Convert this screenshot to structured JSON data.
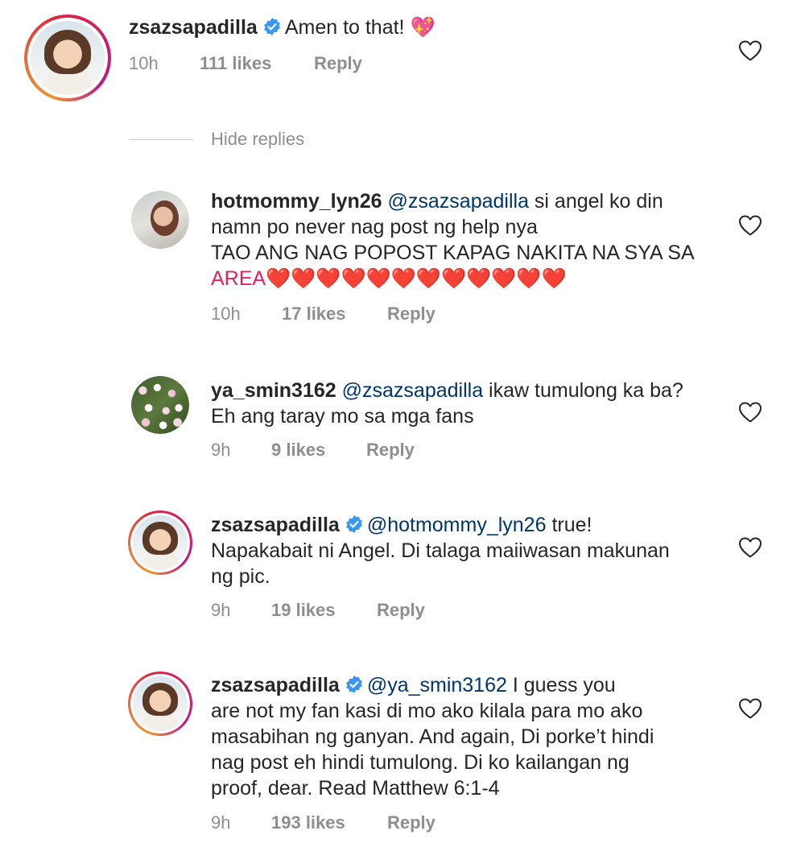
{
  "comments": [
    {
      "username": "zsazsapadilla",
      "verified": true,
      "text": "Amen to that! 💖",
      "time": "10h",
      "likes": "111 likes",
      "reply": "Reply"
    }
  ],
  "hide_replies": "Hide replies",
  "replies": [
    {
      "username": "hotmommy_lyn26",
      "verified": false,
      "mention": "@zsazsapadilla",
      "text_line1": " si angel ko din",
      "text_line2": "namn po never nag post ng help nya",
      "text_line3": "TAO ANG NAG POPOST KAPAG NAKITA NA SYA SA",
      "text_line4": "AREA❤️❤️❤️❤️❤️❤️❤️❤️❤️❤️❤️❤️",
      "time": "10h",
      "likes": "17 likes",
      "reply": "Reply"
    },
    {
      "username": "ya_smin3162",
      "verified": false,
      "mention": "@zsazsapadilla",
      "text_line1": " ikaw tumulong ka ba?",
      "text_line2": "Eh ang taray mo sa mga fans",
      "time": "9h",
      "likes": "9 likes",
      "reply": "Reply"
    },
    {
      "username": "zsazsapadilla",
      "verified": true,
      "mention": "@hotmommy_lyn26",
      "text_line1": " true!",
      "text_line2": "Napakabait ni Angel. Di talaga maiiwasan makunan",
      "text_line3": "ng pic.",
      "time": "9h",
      "likes": "19 likes",
      "reply": "Reply"
    },
    {
      "username": "zsazsapadilla",
      "verified": true,
      "mention": "@ya_smin3162",
      "text_line1": " I guess you",
      "text_line2": "are not my fan kasi di mo ako kilala para mo ako",
      "text_line3": "masabihan ng ganyan. And again, Di porke’t hindi",
      "text_line4": "nag post eh hindi tumulong. Di ko kailangan ng",
      "text_line5": "proof, dear. Read Matthew 6:1-4",
      "time": "9h",
      "likes": "193 likes",
      "reply": "Reply"
    }
  ],
  "icons": {
    "verified": "verified-badge-icon",
    "like": "heart-outline-icon"
  },
  "colors": {
    "text": "#262626",
    "meta": "#8e8e8e",
    "mention": "#003569",
    "verified": "#3897f0"
  }
}
